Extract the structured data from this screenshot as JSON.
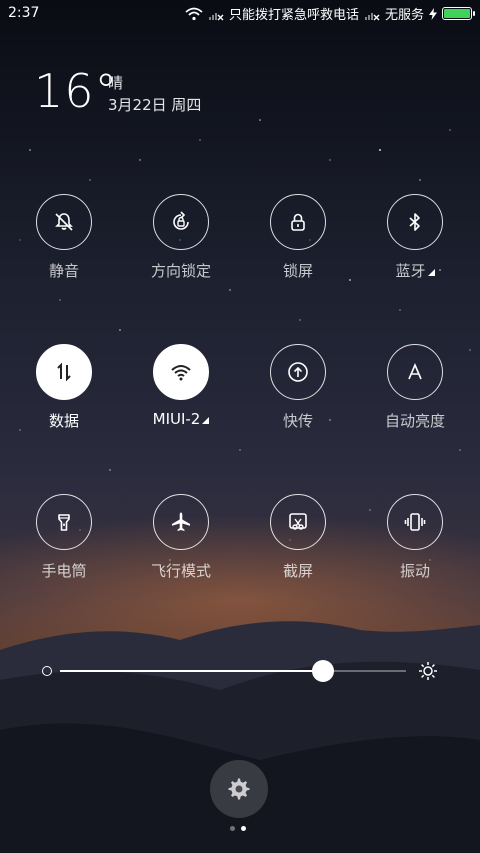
{
  "status_bar": {
    "time": "2:37",
    "carrier_1": "只能拨打紧急呼救电话",
    "carrier_2": "无服务",
    "battery_color": "#3fd35a"
  },
  "weather": {
    "temperature": "16°",
    "condition": "晴",
    "date": "3月22日 周四"
  },
  "toggles": [
    {
      "label": "静音",
      "icon": "bell-off-icon",
      "active": false
    },
    {
      "label": "方向锁定",
      "icon": "rotation-lock-icon",
      "active": false
    },
    {
      "label": "锁屏",
      "icon": "lock-icon",
      "active": false
    },
    {
      "label": "蓝牙",
      "icon": "bluetooth-icon",
      "active": false
    },
    {
      "label": "数据",
      "icon": "data-arrows-icon",
      "active": true
    },
    {
      "label": "MIUI-2",
      "icon": "wifi-icon",
      "active": true
    },
    {
      "label": "快传",
      "icon": "upload-icon",
      "active": false
    },
    {
      "label": "自动亮度",
      "icon": "auto-brightness-icon",
      "active": false
    },
    {
      "label": "手电筒",
      "icon": "flashlight-icon",
      "active": false
    },
    {
      "label": "飞行模式",
      "icon": "airplane-icon",
      "active": false
    },
    {
      "label": "截屏",
      "icon": "screenshot-icon",
      "active": false
    },
    {
      "label": "振动",
      "icon": "vibrate-icon",
      "active": false
    }
  ],
  "brightness": {
    "level": 0.76
  },
  "pager": {
    "pages": 2,
    "current": 2
  }
}
